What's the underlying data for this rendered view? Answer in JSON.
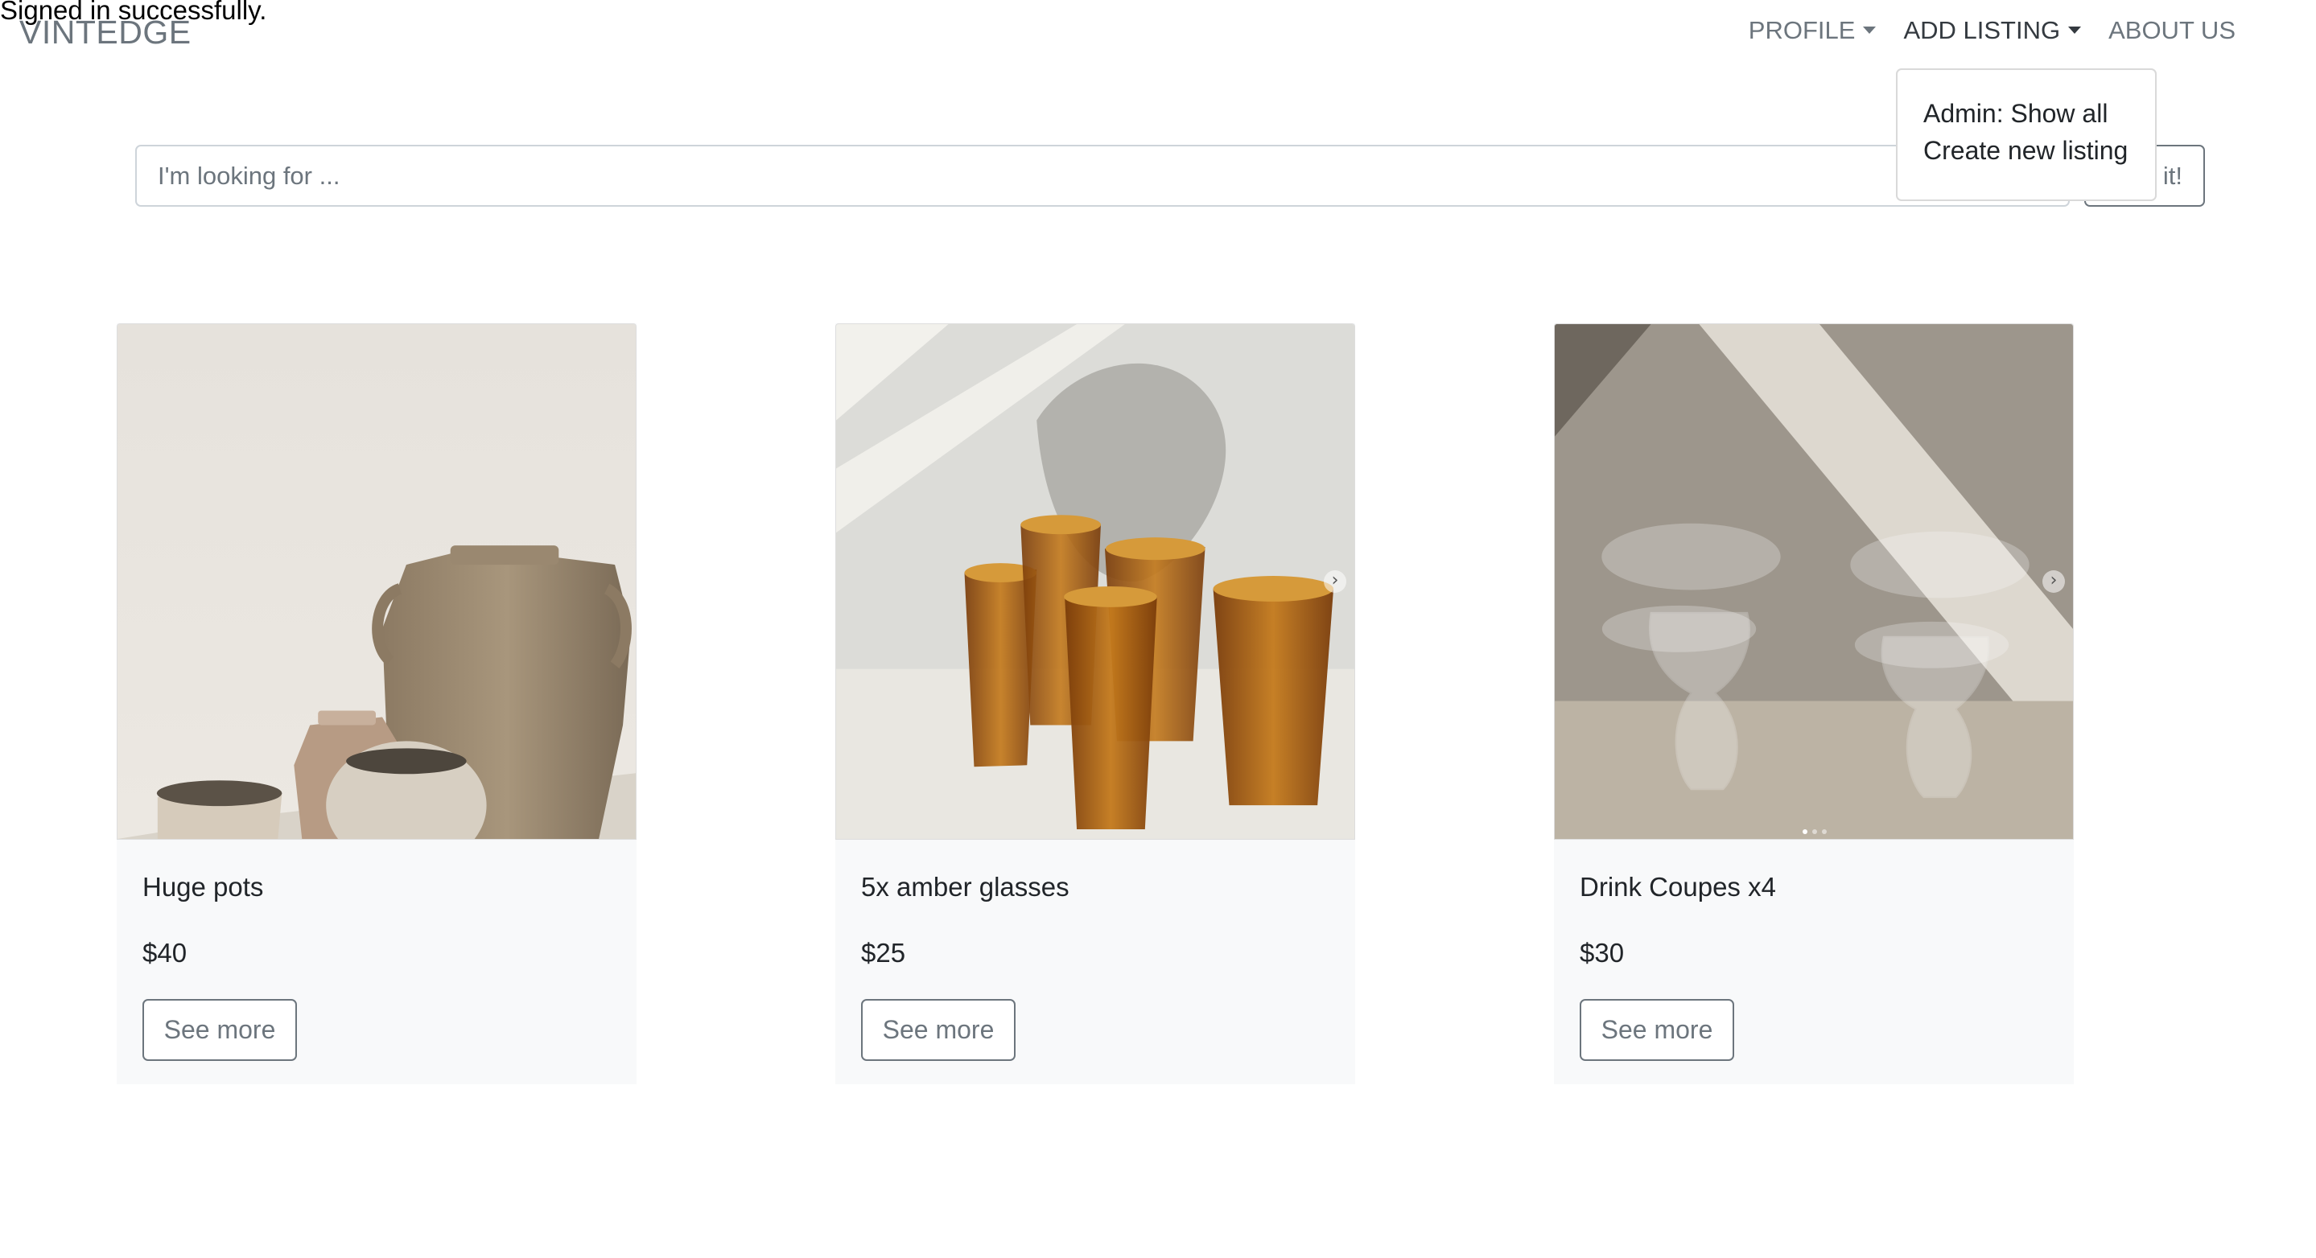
{
  "flash": "Signed in successfully.",
  "navbar": {
    "brand": "VINTEDGE",
    "items": [
      {
        "label": "PROFILE",
        "dropdown": true
      },
      {
        "label": "ADD LISTING",
        "dropdown": true
      },
      {
        "label": "ABOUT US",
        "dropdown": false
      }
    ],
    "dropdown_menu": [
      "Admin: Show all",
      "Create new listing"
    ]
  },
  "search": {
    "placeholder": "I'm looking for ...",
    "button_label": "it!"
  },
  "listings": [
    {
      "title": "Huge pots",
      "price": "$40",
      "button": "See more",
      "image": "pottery-vases-photo"
    },
    {
      "title": "5x amber glasses",
      "price": "$25",
      "button": "See more",
      "image": "amber-glasses-photo"
    },
    {
      "title": "Drink Coupes x4",
      "price": "$30",
      "button": "See more",
      "image": "glass-coupes-photo"
    }
  ]
}
